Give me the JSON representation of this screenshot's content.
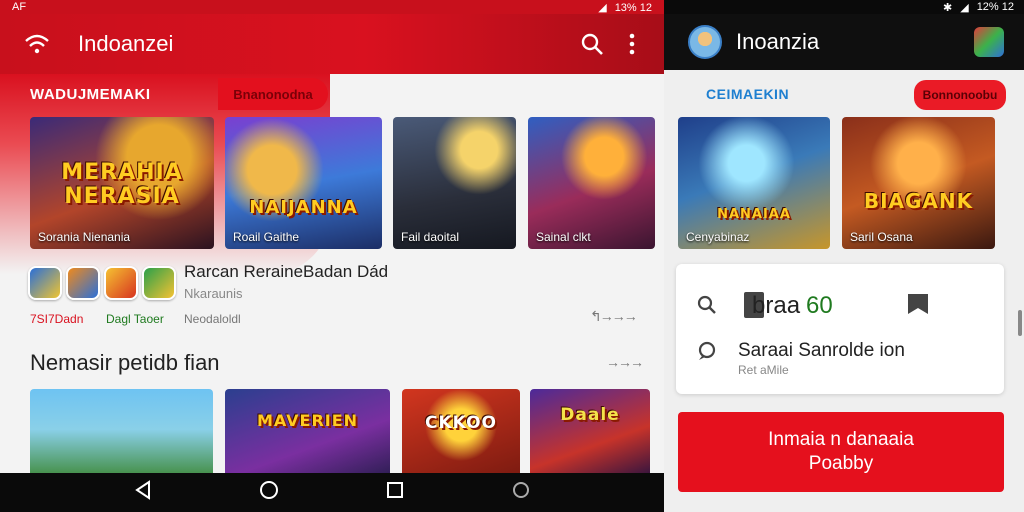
{
  "colors": {
    "brand_red": "#d9111f",
    "dark_header": "#0f0f0f",
    "accent_blue": "#1e7fd0",
    "green_number": "#1f7a1f"
  },
  "left": {
    "status_left": "AF",
    "status_right": "13% 12",
    "header": {
      "title": "Indoanzei",
      "menu_icon": "wifi-icon",
      "search_icon": "search-icon",
      "more_icon": "more-vert-icon"
    },
    "section1": {
      "title": "WADUJMEMAKI",
      "chip": "Bnanonodna",
      "tiles": [
        {
          "overlay": "MERAHIA\nNERASIA",
          "caption": "Sorania Nienania"
        },
        {
          "overlay": "NAIJANNA",
          "caption": "Roail Gaithe"
        },
        {
          "overlay": "",
          "caption": "Fail daoital"
        },
        {
          "overlay": "",
          "caption": "Sainal clkt"
        }
      ]
    },
    "apps": {
      "title": "Rarcan ReraineBadan Dád",
      "subtitle": "Nkaraunis",
      "tags": [
        "7SI7Dadn",
        "Dagl Taoer",
        "Neodaloldl"
      ],
      "arrow": "↰→→→"
    },
    "section2": {
      "title": "Nemasir petidb fian",
      "arrow": "→→→",
      "tiles": [
        {
          "overlay": ""
        },
        {
          "overlay": "MAVERIEN"
        },
        {
          "overlay": "CKKOO"
        },
        {
          "overlay": "Daale"
        }
      ]
    },
    "navbar": [
      "back-icon",
      "home-icon",
      "recents-icon",
      "assistant-icon"
    ]
  },
  "right": {
    "status_right": "12% 12",
    "header": {
      "title": "Inoanzia"
    },
    "section": {
      "title": "CEIMAEKIN",
      "chip": "Bonnonoobu",
      "tiles": [
        {
          "overlay": "NANAIAA",
          "caption": "Cenyabinaz"
        },
        {
          "overlay": "BIAGANK",
          "caption": "Saril Osana"
        }
      ]
    },
    "card": {
      "main_text": "braa",
      "main_number": "60",
      "line2": "Saraai Sanrolde ion",
      "line3": "Ret aMile"
    },
    "cta": {
      "line1": "Inmaia n danaaia",
      "line2": "Poabby"
    }
  }
}
